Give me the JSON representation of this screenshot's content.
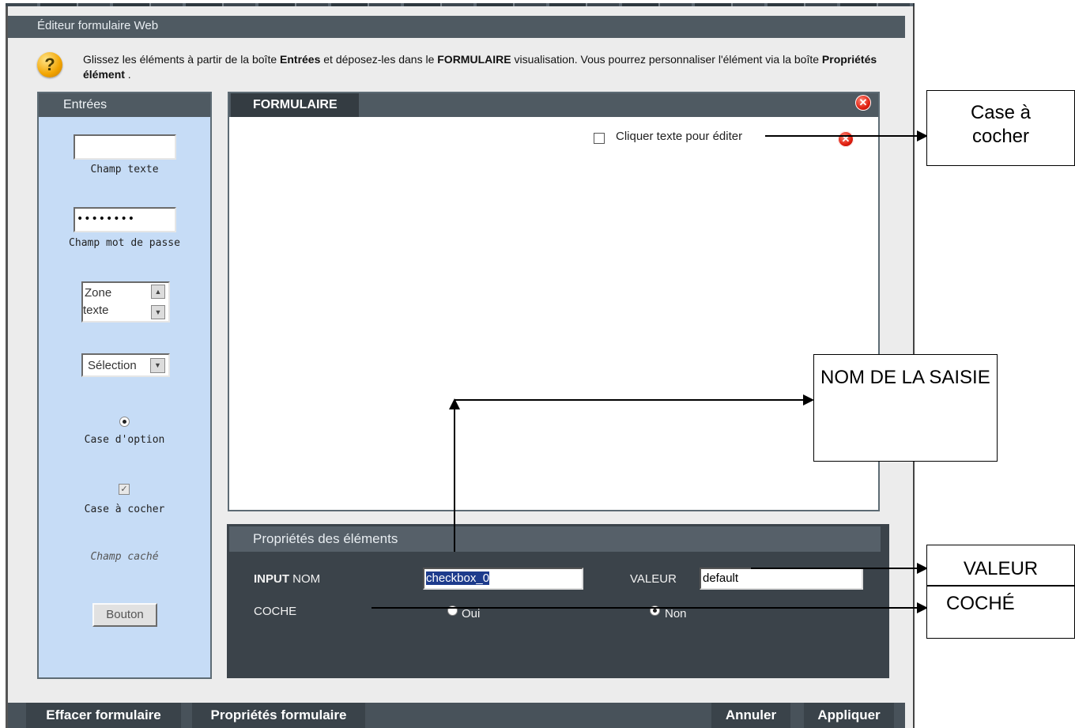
{
  "window": {
    "title": "Éditeur formulaire Web"
  },
  "help": {
    "text_pre": "Glissez les éléments à partir de la boîte ",
    "bold1": "Entrées",
    "text_mid1": " et déposez-les dans le ",
    "bold2": "FORMULAIRE",
    "text_mid2": " visualisation. Vous pourrez personnaliser l'élément via la boîte ",
    "bold3": "Propriétés élément",
    "text_end": " ."
  },
  "palette": {
    "title": "Entrées",
    "items": [
      {
        "label": "Champ texte"
      },
      {
        "label": "Champ mot de passe",
        "value": "••••••••"
      },
      {
        "label": "Zone texte",
        "line1": "Zone",
        "line2": "texte"
      },
      {
        "label": "Sélection"
      },
      {
        "label": "Case d'option"
      },
      {
        "label": "Case à cocher"
      },
      {
        "label": "Champ caché"
      },
      {
        "label": "Bouton"
      }
    ]
  },
  "form": {
    "title": "FORMULAIRE",
    "checkbox_label": "Cliquer texte pour éditer"
  },
  "properties": {
    "title": "Propriétés des éléments",
    "input_bold": "INPUT",
    "input_label": " NOM",
    "name_value": "checkbox_0",
    "value_label": "VALEUR",
    "value_value": "default",
    "checked_label": "COCHE",
    "radio_yes": "Oui",
    "radio_no": "Non",
    "checked_selection": "Non"
  },
  "bottom_bar": {
    "clear": "Effacer formulaire",
    "form_props": "Propriétés formulaire",
    "cancel": "Annuler",
    "apply": "Appliquer"
  },
  "annotations": {
    "checkbox": "Case à cocher",
    "name": "NOM DE LA SAISIE",
    "value": "VALEUR",
    "checked": "COCHÉ"
  },
  "colors": {
    "panel_dark": "#4f5a62",
    "palette_bg": "#c6dcf6",
    "close_red": "#e02010",
    "help_orange": "#f2a400"
  },
  "icons": [
    "help-icon",
    "close-icon",
    "checkbox-icon",
    "radio-icon",
    "scroll-up-icon",
    "scroll-down-icon",
    "dropdown-arrow-icon"
  ]
}
